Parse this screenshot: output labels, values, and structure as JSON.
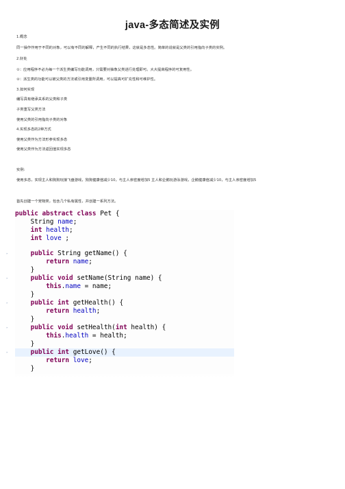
{
  "document": {
    "title": "java-多态简述及实例",
    "paragraphs": [
      "1.概念",
      "同一操作作用于不同的对象，可以有不同的解释，产生不同的执行结果，这就是多态性。简单的说就是父类的引用指向子类的实例。",
      "2.好处",
      "①：应用程序不必为每一个派生类编写功能调用，只需要对抽象父类进行处理即可。大大提高程序的可复用性。",
      "②：派生类的功能可以被父类的方法或引用变量所调用，可以提高可扩充性和可维护性。",
      "3.如何实现",
      "编写具有继承关系的父类和子类",
      "子类重写父类方法",
      "使用父类的引用指向子类的对象",
      "4.实现多态的2种方式",
      "使用父类作为方法形参实现多态",
      "使用父类作为方法返回值实现多态",
      "实例:",
      "使用多态，实现主人和狗狗玩接飞盘游戏，狗狗健康值减少10，与主人亲密度增加5 主人和企鹅玩游泳游戏，企鹅健康值减少10，与主人亲密度增加5",
      "首先创建一个宠物类，包含几个私有属性，并创建一系列方法。"
    ]
  },
  "code": {
    "language": "java",
    "colors": {
      "keyword": "#7f0055",
      "field": "#0000c0",
      "highlight": "#e8f2fe"
    },
    "highlighted_line": 15,
    "lines": [
      "public abstract class Pet {",
      "    String name;",
      "    int health;",
      "    int love ;",
      "",
      "    public String getName() {",
      "        return name;",
      "    }",
      "    public void setName(String name) {",
      "        this.name = name;",
      "    }",
      "    public int getHealth() {",
      "        return health;",
      "    }",
      "    public void setHealth(int health) {",
      "        this.health = health;",
      "    }",
      "    public int getLove() {",
      "        return love;",
      "    }"
    ]
  }
}
